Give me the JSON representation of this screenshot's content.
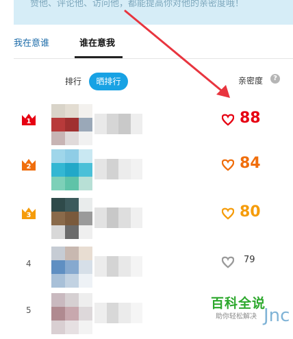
{
  "banner": {
    "text": "赞他、评论他、访问他，都能提高你对他的亲密度哦！"
  },
  "tabs": [
    {
      "label": "我在意谁"
    },
    {
      "label": "谁在意我"
    }
  ],
  "sort": {
    "rank_label": "排行",
    "show_rank_label": "晒排行"
  },
  "intimacy": {
    "label": "亲密度",
    "help": "?"
  },
  "colors": {
    "accent": "#18a2e4",
    "rank1": "#e60012",
    "rank2": "#f06e0c",
    "rank3": "#f59c0b",
    "arrow": "#e8353f",
    "brand_green": "#2da82d"
  },
  "rows": [
    {
      "rank": "1",
      "score": "88",
      "color": "#e60012"
    },
    {
      "rank": "2",
      "score": "84",
      "color": "#f06e0c"
    },
    {
      "rank": "3",
      "score": "80",
      "color": "#f59c0b"
    },
    {
      "rank": "4",
      "score": "79",
      "color": "#9a9a9a"
    },
    {
      "rank": "5",
      "score": "",
      "color": "#9a9a9a"
    }
  ],
  "watermark": {
    "title": "百科全说",
    "subtitle": "助你轻松解决",
    "logo": "Jnc"
  }
}
